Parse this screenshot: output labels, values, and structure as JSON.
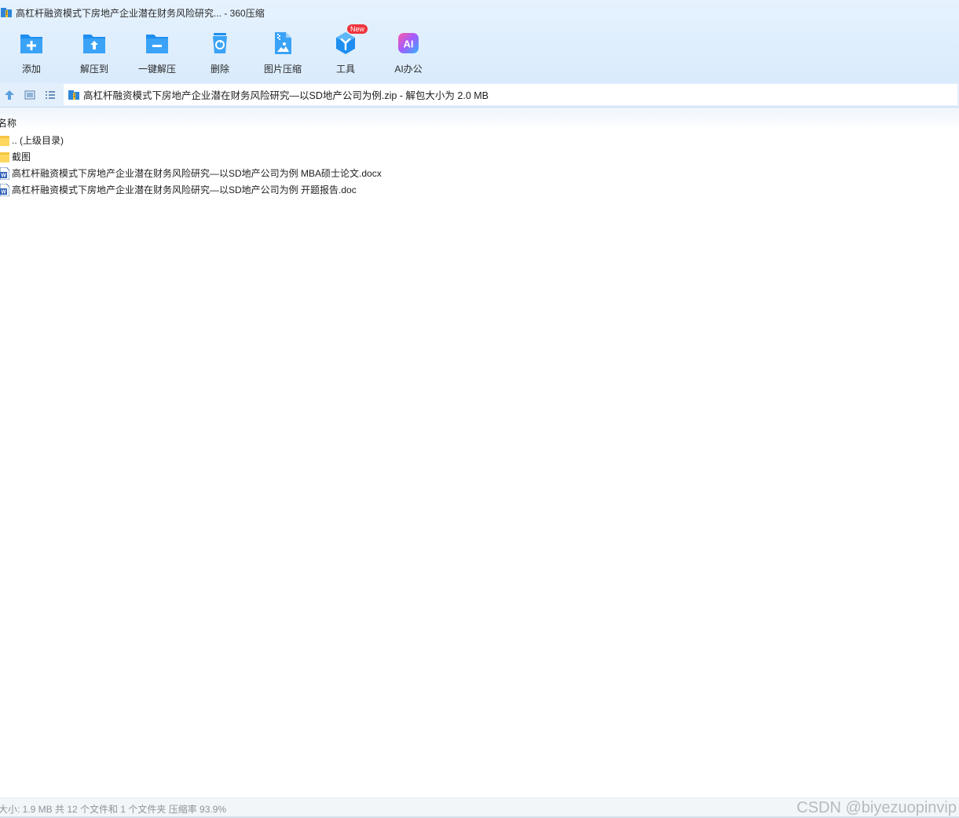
{
  "window": {
    "title": "高杠杆融资模式下房地产企业潜在财务风险研究... - 360压缩"
  },
  "toolbar": {
    "items": [
      {
        "label": "添加",
        "icon": "add-folder-icon"
      },
      {
        "label": "解压到",
        "icon": "extract-to-icon"
      },
      {
        "label": "一键解压",
        "icon": "one-click-extract-icon"
      },
      {
        "label": "删除",
        "icon": "recycle-bin-icon"
      },
      {
        "label": "图片压缩",
        "icon": "image-compress-icon"
      },
      {
        "label": "工具",
        "icon": "tools-cube-icon",
        "badge": "New"
      },
      {
        "label": "AI办公",
        "icon": "ai-office-icon",
        "icon_text": "AI"
      }
    ]
  },
  "addressbar": {
    "path": "高杠杆融资模式下房地产企业潜在财务风险研究—以SD地产公司为例.zip - 解包大小为 2.0 MB"
  },
  "filelist": {
    "header_name": "名称",
    "rows": [
      {
        "label": ".. (上级目录)",
        "type": "folder"
      },
      {
        "label": "截图",
        "type": "folder"
      },
      {
        "label": "高杠杆融资模式下房地产企业潜在财务风险研究—以SD地产公司为例 MBA硕士论文.docx",
        "type": "word"
      },
      {
        "label": "高杠杆融资模式下房地产企业潜在财务风险研究—以SD地产公司为例 开题报告.doc",
        "type": "word"
      }
    ]
  },
  "status": {
    "text": "大小: 1.9 MB 共 12 个文件和 1 个文件夹 压缩率 93.9%",
    "watermark": "CSDN @biyezuopinvip"
  },
  "colors": {
    "accent": "#1e8ef0",
    "badge": "#f0343d",
    "folder": "#ffd75e"
  }
}
